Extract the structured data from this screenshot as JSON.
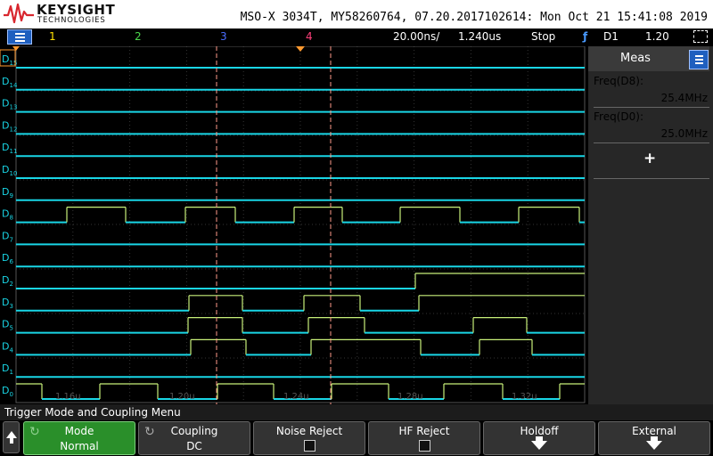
{
  "header": {
    "brand": "KEYSIGHT",
    "brand_sub": "TECHNOLOGIES",
    "instrument": "MSO-X 3034T, MY58260764, 07.20.2017102614: Mon Oct 21 15:41:08 2019"
  },
  "status_bar": {
    "ch1": "1",
    "ch2": "2",
    "ch3": "3",
    "ch4": "4",
    "timebase": "20.00ns/",
    "delay": "1.240us",
    "run_state": "Stop",
    "trigger_source": "D1",
    "trigger_level": "1.20",
    "colors": {
      "ch1": "#ffe000",
      "ch2": "#4cd64c",
      "ch3": "#4a6cff",
      "ch4": "#ff3f7a"
    }
  },
  "waveform": {
    "digital_labels": [
      {
        "main": "D",
        "sub": "15"
      },
      {
        "main": "D",
        "sub": "14"
      },
      {
        "main": "D",
        "sub": "13"
      },
      {
        "main": "D",
        "sub": "12"
      },
      {
        "main": "D",
        "sub": "11"
      },
      {
        "main": "D",
        "sub": "10"
      },
      {
        "main": "D",
        "sub": "9"
      },
      {
        "main": "D",
        "sub": "8"
      },
      {
        "main": "D",
        "sub": "7"
      },
      {
        "main": "D",
        "sub": "6"
      },
      {
        "main": "D",
        "sub": "2"
      },
      {
        "main": "D",
        "sub": "3"
      },
      {
        "main": "D",
        "sub": "5"
      },
      {
        "main": "D",
        "sub": "4"
      },
      {
        "main": "D",
        "sub": "1"
      },
      {
        "main": "D",
        "sub": "0"
      }
    ],
    "time_labels": [
      "1.16u",
      "1.20u",
      "1.24u",
      "1.28u",
      "1.32u"
    ],
    "trace_color": "#19d6e6",
    "high_color": "#c8f07a",
    "cursor_color": "#ff9a8a"
  },
  "measurements": {
    "title": "Meas",
    "items": [
      {
        "label": "Freq(D8):",
        "value": "25.4MHz",
        "color": "#ffffff"
      },
      {
        "label": "Freq(D0):",
        "value": "25.0MHz",
        "color": "#ffa020"
      }
    ],
    "add_symbol": "+"
  },
  "menu": {
    "title": "Trigger Mode and Coupling Menu",
    "softkeys": [
      {
        "line1": "Mode",
        "line2": "Normal",
        "selected": true
      },
      {
        "line1": "Coupling",
        "line2": "DC",
        "selected": false
      },
      {
        "line1": "Noise Reject",
        "line2": "",
        "selected": false
      },
      {
        "line1": "HF Reject",
        "line2": "",
        "selected": false
      },
      {
        "line1": "Holdoff",
        "line2": "",
        "selected": false
      },
      {
        "line1": "External",
        "line2": "",
        "selected": false
      }
    ]
  }
}
